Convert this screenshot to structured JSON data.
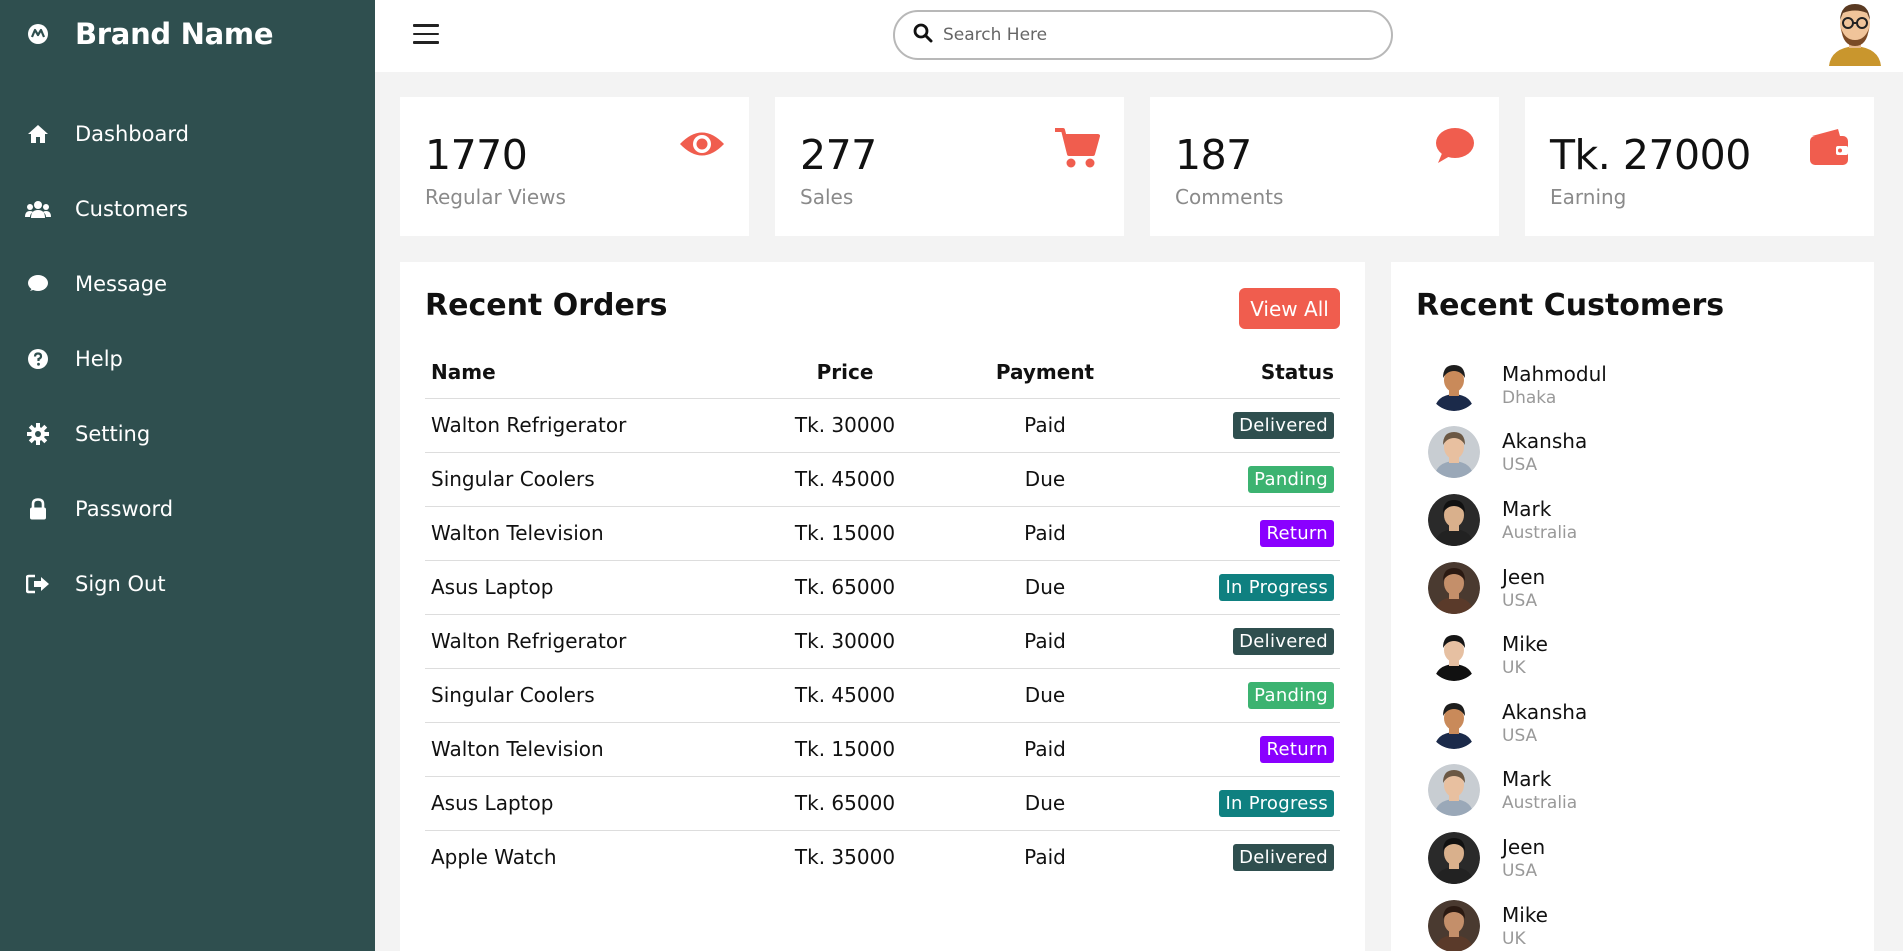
{
  "brand": {
    "name": "Brand Name",
    "icon": "logo-icon"
  },
  "sidebar": {
    "items": [
      {
        "label": "Dashboard",
        "icon": "home-icon"
      },
      {
        "label": "Customers",
        "icon": "users-icon"
      },
      {
        "label": "Message",
        "icon": "chat-icon"
      },
      {
        "label": "Help",
        "icon": "help-icon"
      },
      {
        "label": "Setting",
        "icon": "gear-icon"
      },
      {
        "label": "Password",
        "icon": "lock-icon"
      },
      {
        "label": "Sign Out",
        "icon": "sign-out-icon"
      }
    ]
  },
  "search": {
    "placeholder": "Search Here"
  },
  "cards": [
    {
      "value": "1770",
      "label": "Regular Views",
      "icon": "eye-icon"
    },
    {
      "value": "277",
      "label": "Sales",
      "icon": "cart-icon"
    },
    {
      "value": "187",
      "label": "Comments",
      "icon": "comment-icon"
    },
    {
      "value": "Tk. 27000",
      "label": "Earning",
      "icon": "wallet-icon"
    }
  ],
  "orders": {
    "title": "Recent Orders",
    "view_all": "View All",
    "columns": [
      "Name",
      "Price",
      "Payment",
      "Status"
    ],
    "rows": [
      {
        "name": "Walton Refrigerator",
        "price": "Tk. 30000",
        "payment": "Paid",
        "status": "Delivered",
        "color": "#2f4f4f"
      },
      {
        "name": "Singular Coolers",
        "price": "Tk. 45000",
        "payment": "Due",
        "status": "Panding",
        "color": "#3cb371"
      },
      {
        "name": "Walton Television",
        "price": "Tk. 15000",
        "payment": "Paid",
        "status": "Return",
        "color": "#8a00ff"
      },
      {
        "name": "Asus Laptop",
        "price": "Tk. 65000",
        "payment": "Due",
        "status": "In Progress",
        "color": "#0f8080"
      },
      {
        "name": "Walton Refrigerator",
        "price": "Tk. 30000",
        "payment": "Paid",
        "status": "Delivered",
        "color": "#2f4f4f"
      },
      {
        "name": "Singular Coolers",
        "price": "Tk. 45000",
        "payment": "Due",
        "status": "Panding",
        "color": "#3cb371"
      },
      {
        "name": "Walton Television",
        "price": "Tk. 15000",
        "payment": "Paid",
        "status": "Return",
        "color": "#8a00ff"
      },
      {
        "name": "Asus Laptop",
        "price": "Tk. 65000",
        "payment": "Due",
        "status": "In Progress",
        "color": "#0f8080"
      },
      {
        "name": "Apple Watch",
        "price": "Tk. 35000",
        "payment": "Paid",
        "status": "Delivered",
        "color": "#2f4f4f"
      }
    ]
  },
  "customers": {
    "title": "Recent Customers",
    "items": [
      {
        "name": "Mahmodul",
        "city": "Dhaka"
      },
      {
        "name": "Akansha",
        "city": "USA"
      },
      {
        "name": "Mark",
        "city": "Australia"
      },
      {
        "name": "Jeen",
        "city": "USA"
      },
      {
        "name": "Mike",
        "city": "UK"
      },
      {
        "name": "Akansha",
        "city": "USA"
      },
      {
        "name": "Mark",
        "city": "Australia"
      },
      {
        "name": "Jeen",
        "city": "USA"
      },
      {
        "name": "Mike",
        "city": "UK"
      }
    ]
  },
  "colors": {
    "sidebar": "#2f4f4f",
    "accent": "#f05d4e"
  }
}
